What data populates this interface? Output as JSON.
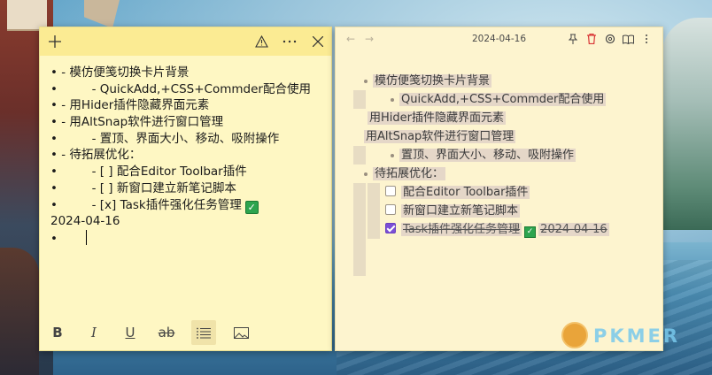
{
  "note": {
    "lines": [
      {
        "prefix": "• - ",
        "text": "模仿便笺切换卡片背景"
      },
      {
        "prefix": "•         - ",
        "text": "QuickAdd,+CSS+Commder配合使用"
      },
      {
        "prefix": "• - ",
        "text": "用Hider插件隐藏界面元素"
      },
      {
        "prefix": "• - ",
        "text": "用AltSnap软件进行窗口管理"
      },
      {
        "prefix": "•         - ",
        "text": "置顶、界面大小、移动、吸附操作"
      },
      {
        "prefix": "• - ",
        "text": "待拓展优化："
      },
      {
        "prefix": "•         - ",
        "text": "[ ] 配合Editor Toolbar插件"
      },
      {
        "prefix": "•         - ",
        "text": "[ ] 新窗口建立新笔记脚本"
      },
      {
        "prefix": "•         - ",
        "text": "[x] Task插件强化任务管理"
      },
      {
        "prefix": "",
        "text": "2024-04-16"
      },
      {
        "prefix": "•",
        "text": ""
      }
    ],
    "check_glyph": "✓",
    "toolbar": {
      "bold": "B",
      "italic": "I",
      "underline": "U",
      "strike": "ab"
    }
  },
  "preview": {
    "title": "2024-04-16",
    "items": [
      {
        "text": "模仿便笺切换卡片背景"
      },
      {
        "text": "QuickAdd,+CSS+Commder配合使用"
      },
      {
        "text": "用Hider插件隐藏界面元素"
      },
      {
        "text": "用AltSnap软件进行窗口管理"
      },
      {
        "text": "置顶、界面大小、移动、吸附操作"
      },
      {
        "text": "待拓展优化："
      },
      {
        "text": "配合Editor Toolbar插件"
      },
      {
        "text": "新窗口建立新笔记脚本"
      },
      {
        "text": "Task插件强化任务管理",
        "date": "2024-04-16"
      }
    ]
  },
  "watermark": {
    "brand": "PKMER"
  },
  "colors": {
    "note_bg": "#fef7c3",
    "note_titlebar": "#fbeb93",
    "preview_bg": "#fdf4cf",
    "delete_icon": "#d93636",
    "task_checkbox": "#7b4fd6"
  }
}
